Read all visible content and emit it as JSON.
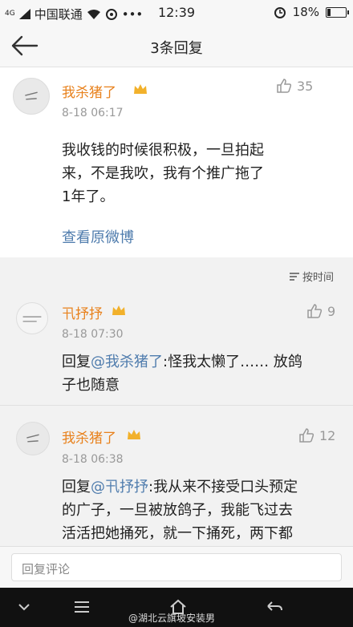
{
  "status_bar": {
    "signal": "4G",
    "carrier": "中国联通",
    "more": "•••",
    "time": "12:39",
    "battery": "18%",
    "battery_level": 0.18
  },
  "nav": {
    "title": "3条回复"
  },
  "post": {
    "username": "我杀猪了",
    "likes": "35",
    "date": "8-18 06:17",
    "text_lines": [
      "我收钱的时候很积极，一旦拍起",
      "来，不是我吹，我有个推广拖了",
      "1年了。"
    ],
    "view_original": "查看原微博"
  },
  "sort": {
    "label": "按时间"
  },
  "comments": [
    {
      "username": "卂抒抒",
      "likes": "9",
      "date": "8-18 07:30",
      "reply_prefix": "回复",
      "mention": "@我杀猪了",
      "text_line1": ":怪我太懒了…… 放鸽",
      "text_line2": "子也随意"
    },
    {
      "username": "我杀猪了",
      "likes": "12",
      "date": "8-18 06:38",
      "reply_prefix": "回复",
      "mention": "@卂抒抒",
      "text_line1": ":我从来不接受口头预定",
      "text_line2": "的广子，一旦被放鸽子，我能飞过去",
      "text_line3": "活活把她捅死，就一下捅死，两下都"
    }
  ],
  "reply_bar": {
    "placeholder": "回复评论"
  },
  "watermark": "@湖北云旗坡安装男"
}
